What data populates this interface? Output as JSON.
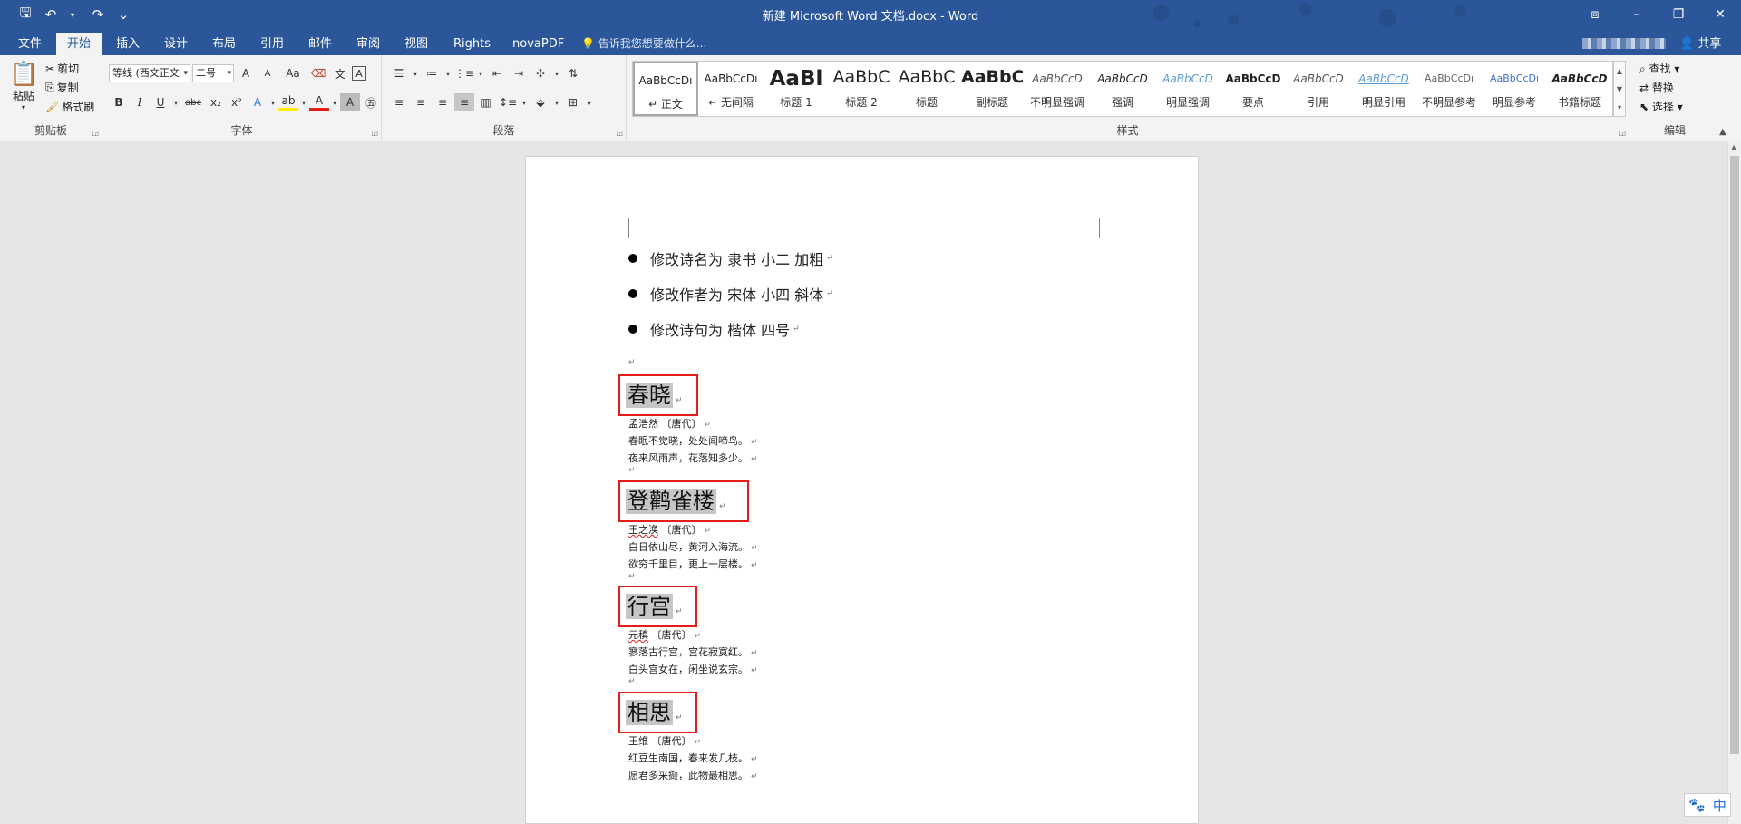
{
  "window": {
    "title": "新建 Microsoft Word 文档.docx - Word",
    "controls": [
      "⧈",
      "–",
      "❐",
      "✕"
    ]
  },
  "qat": {
    "save": "🖫",
    "undo": "↶",
    "redo": "↷",
    "custom": "⌄"
  },
  "tabs": [
    "文件",
    "开始",
    "插入",
    "设计",
    "布局",
    "引用",
    "邮件",
    "审阅",
    "视图",
    "Rights",
    "novaPDF"
  ],
  "active_tab": "开始",
  "tellme": "告诉我您想要做什么...",
  "share": "共享",
  "clipboard": {
    "paste": "粘贴",
    "cut": "剪切",
    "copy": "复制",
    "format_painter": "格式刷",
    "label": "剪贴板"
  },
  "font": {
    "name": "等线 (西文正文",
    "size": "二号",
    "label": "字体",
    "grow": "A",
    "shrink": "A",
    "case": "Aa",
    "bold": "B",
    "italic": "I",
    "underline": "U",
    "strike": "abc",
    "subscript": "x₂",
    "superscript": "x²"
  },
  "paragraph": {
    "label": "段落"
  },
  "styles": {
    "label": "样式",
    "items": [
      {
        "preview": "AaBbCcDı",
        "name": "↵ 正文"
      },
      {
        "preview": "AaBbCcDı",
        "name": "↵ 无间隔"
      },
      {
        "preview": "AaBl",
        "name": "标题 1"
      },
      {
        "preview": "AaBbC",
        "name": "标题 2"
      },
      {
        "preview": "AaBbC",
        "name": "标题"
      },
      {
        "preview": "AaBbC",
        "name": "副标题"
      },
      {
        "preview": "AaBbCcD",
        "name": "不明显强调"
      },
      {
        "preview": "AaBbCcD",
        "name": "强调"
      },
      {
        "preview": "AaBbCcD",
        "name": "明显强调"
      },
      {
        "preview": "AaBbCcD",
        "name": "要点"
      },
      {
        "preview": "AaBbCcD",
        "name": "引用"
      },
      {
        "preview": "AaBbCcD",
        "name": "明显引用"
      },
      {
        "preview": "AaBbCcDı",
        "name": "不明显参考"
      },
      {
        "preview": "AaBbCcDı",
        "name": "明显参考"
      },
      {
        "preview": "AaBbCcD",
        "name": "书籍标题"
      }
    ]
  },
  "editing": {
    "find": "查找",
    "replace": "替换",
    "select": "选择",
    "label": "编辑"
  },
  "doc": {
    "bullets": [
      "修改诗名为  隶书  小二  加粗 ",
      "修改作者为  宋体  小四  斜体",
      "修改诗句为  楷体  四号"
    ],
    "pilcrow": "↵",
    "poems": [
      {
        "title": "春晓",
        "author_name": "孟浩然",
        "dynasty": "〔唐代〕",
        "lines": [
          "春眠不觉晓，处处闻啼鸟。",
          "夜来风雨声，花落知多少。"
        ]
      },
      {
        "title": "登鹳雀楼",
        "author_name": "王之涣",
        "dynasty": "〔唐代〕",
        "lines": [
          "白日依山尽，黄河入海流。",
          "欲穷千里目，更上一层楼。"
        ]
      },
      {
        "title": "行宫",
        "author_name": "元稹",
        "dynasty": "〔唐代〕",
        "lines": [
          "寥落古行宫，宫花寂寞红。",
          "白头宫女在，闲坐说玄宗。"
        ]
      },
      {
        "title": "相思",
        "author_name": "王维",
        "dynasty": "〔唐代〕",
        "lines": [
          "红豆生南国，春来发几枝。",
          "愿君多采撷，此物最相思。"
        ]
      }
    ]
  },
  "ime": {
    "icon": "🐾",
    "lang": "中"
  }
}
